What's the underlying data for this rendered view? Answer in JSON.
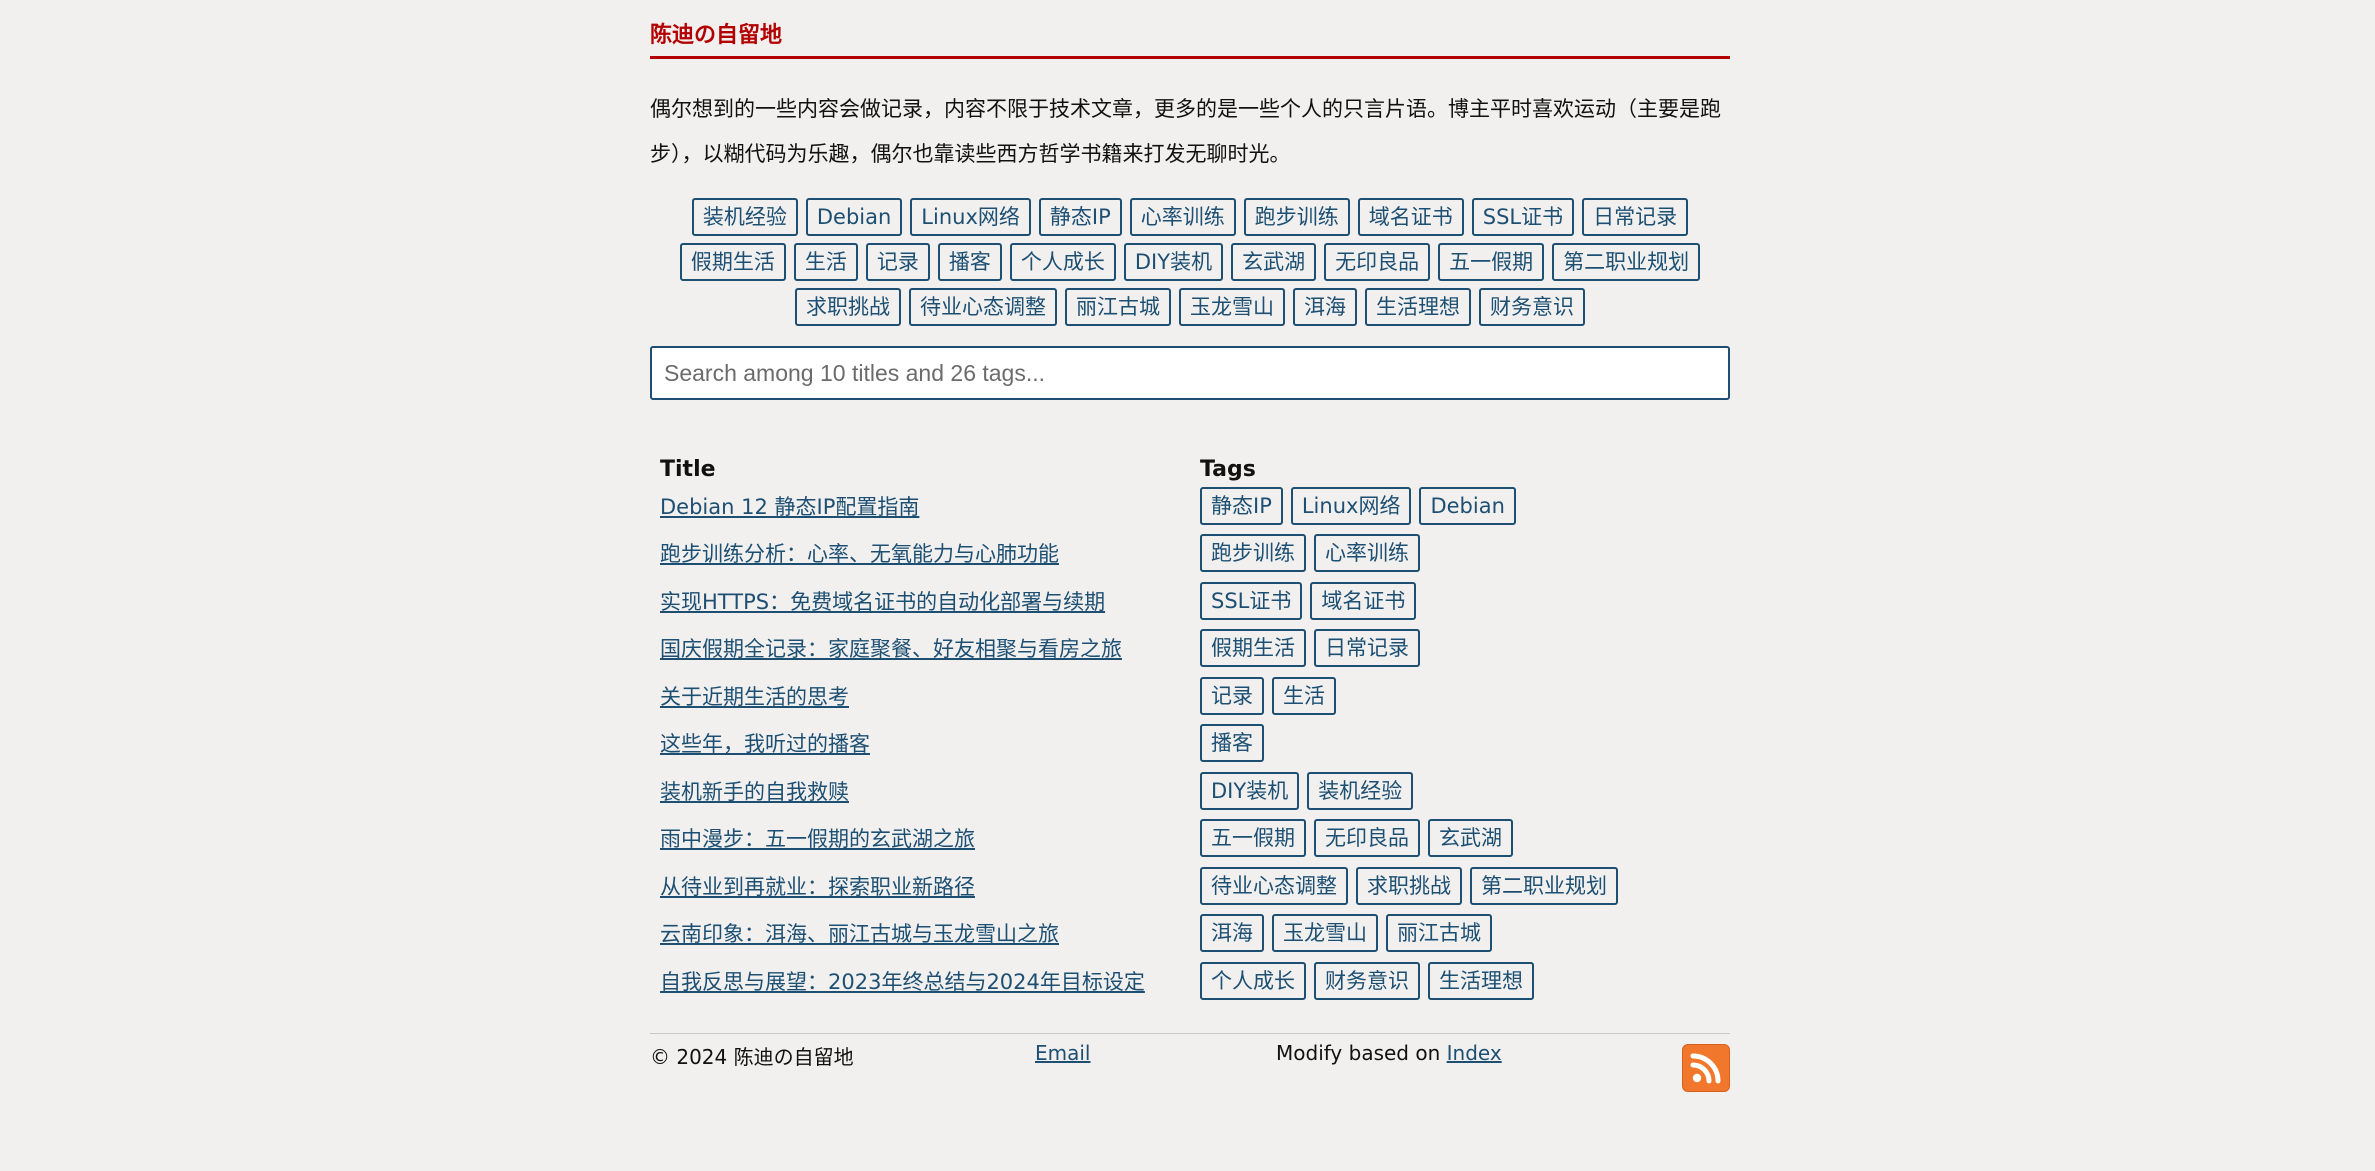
{
  "site": {
    "title": "陈迪の自留地"
  },
  "intro": "偶尔想到的一些内容会做记录，内容不限于技术文章，更多的是一些个人的只言片语。博主平时喜欢运动（主要是跑步），以糊代码为乐趣，偶尔也靠读些西方哲学书籍来打发无聊时光。",
  "tag_cloud": [
    "装机经验",
    "Debian",
    "Linux网络",
    "静态IP",
    "心率训练",
    "跑步训练",
    "域名证书",
    "SSL证书",
    "日常记录",
    "假期生活",
    "生活",
    "记录",
    "播客",
    "个人成长",
    "DIY装机",
    "玄武湖",
    "无印良品",
    "五一假期",
    "第二职业规划",
    "求职挑战",
    "待业心态调整",
    "丽江古城",
    "玉龙雪山",
    "洱海",
    "生活理想",
    "财务意识"
  ],
  "search": {
    "placeholder": "Search among 10 titles and 26 tags..."
  },
  "table": {
    "headers": {
      "title": "Title",
      "tags": "Tags"
    },
    "rows": [
      {
        "title": "Debian 12 静态IP配置指南",
        "tags": [
          "静态IP",
          "Linux网络",
          "Debian"
        ]
      },
      {
        "title": "跑步训练分析：心率、无氧能力与心肺功能",
        "tags": [
          "跑步训练",
          "心率训练"
        ]
      },
      {
        "title": "实现HTTPS：免费域名证书的自动化部署与续期",
        "tags": [
          "SSL证书",
          "域名证书"
        ]
      },
      {
        "title": "国庆假期全记录：家庭聚餐、好友相聚与看房之旅",
        "tags": [
          "假期生活",
          "日常记录"
        ]
      },
      {
        "title": "关于近期生活的思考",
        "tags": [
          "记录",
          "生活"
        ]
      },
      {
        "title": "这些年，我听过的播客",
        "tags": [
          "播客"
        ]
      },
      {
        "title": "装机新手的自我救赎",
        "tags": [
          "DIY装机",
          "装机经验"
        ]
      },
      {
        "title": "雨中漫步：五一假期的玄武湖之旅",
        "tags": [
          "五一假期",
          "无印良品",
          "玄武湖"
        ]
      },
      {
        "title": "从待业到再就业：探索职业新路径",
        "tags": [
          "待业心态调整",
          "求职挑战",
          "第二职业规划"
        ]
      },
      {
        "title": "云南印象：洱海、丽江古城与玉龙雪山之旅",
        "tags": [
          "洱海",
          "玉龙雪山",
          "丽江古城"
        ]
      },
      {
        "title": "自我反思与展望：2023年终总结与2024年目标设定",
        "tags": [
          "个人成长",
          "财务意识",
          "生活理想"
        ]
      }
    ]
  },
  "footer": {
    "copyright": "© 2024 陈迪の自留地",
    "email_label": "Email",
    "modify_text": "Modify based on ",
    "index_label": "Index",
    "rss_icon": "rss-icon"
  },
  "colors": {
    "accent": "#b30000",
    "link": "#1d4f73",
    "rss": "#f0772c",
    "background": "#f1f0ef"
  }
}
